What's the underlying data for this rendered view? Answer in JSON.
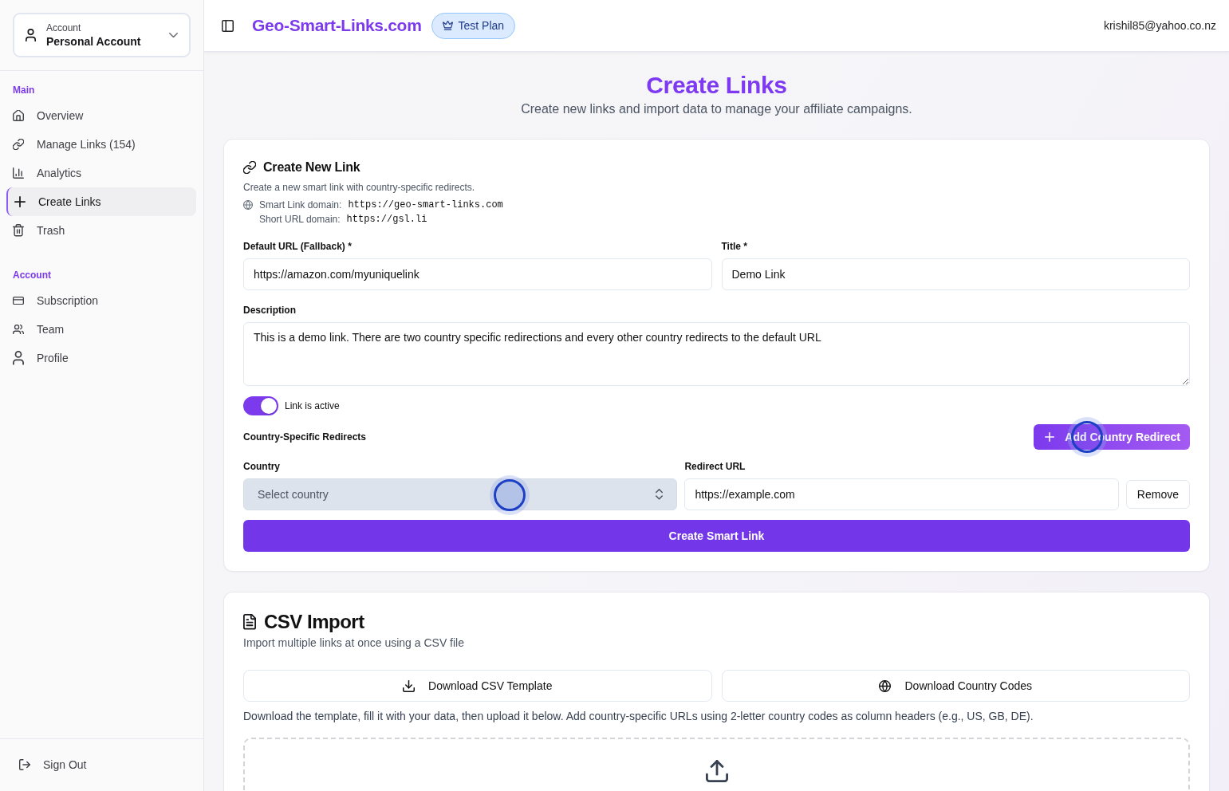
{
  "sidebar": {
    "account_selector": {
      "label": "Account",
      "value": "Personal Account"
    },
    "sections": [
      {
        "heading": "Main",
        "items": [
          {
            "label": "Overview",
            "selected": false
          },
          {
            "label": "Manage Links (154)",
            "selected": false
          },
          {
            "label": "Analytics",
            "selected": false
          },
          {
            "label": "Create Links",
            "selected": true
          },
          {
            "label": "Trash",
            "selected": false
          }
        ]
      },
      {
        "heading": "Account",
        "items": [
          {
            "label": "Subscription",
            "selected": false
          },
          {
            "label": "Team",
            "selected": false
          },
          {
            "label": "Profile",
            "selected": false
          }
        ]
      }
    ],
    "sign_out": "Sign Out"
  },
  "header": {
    "brand": "Geo-Smart-Links.com",
    "plan_badge": "Test Plan",
    "user_email": "krishil85@yahoo.co.nz"
  },
  "page": {
    "title": "Create Links",
    "subtitle": "Create new links and import data to manage your affiliate campaigns."
  },
  "create_link": {
    "title": "Create New Link",
    "description": "Create a new smart link with country-specific redirects.",
    "domains": [
      {
        "label": "Smart Link domain:",
        "value": "https://geo-smart-links.com"
      },
      {
        "label": "Short URL domain:",
        "value": "https://gsl.li"
      }
    ],
    "fields": [
      {
        "label": "Default URL (Fallback) *",
        "value": "https://amazon.com/myuniquelink"
      },
      {
        "label": "Title *",
        "value": "Demo Link"
      }
    ],
    "description_field": {
      "label": "Description",
      "value": "This is a demo link. There are two country specific redirections and every other country redirects to the default URL"
    },
    "active_toggle": {
      "label": "Link is active",
      "on": true
    },
    "redirects": {
      "heading": "Country-Specific Redirects",
      "add_button": {
        "label": "Add Country Redirect",
        "clicked": true
      },
      "country_label": "Country",
      "url_label": "Redirect URL",
      "rows": [
        {
          "country": {
            "placeholder": "Select country",
            "clicked": true
          },
          "url": "https://example.com",
          "remove_button": "Remove"
        }
      ]
    },
    "submit_button": "Create Smart Link"
  },
  "csv_import": {
    "title": "CSV Import",
    "subtitle": "Import multiple links at once using a CSV file",
    "buttons": [
      "Download CSV Template",
      "Download Country Codes"
    ],
    "instructions": "Download the template, fill it with your data, then upload it below. Add country-specific URLs using 2-letter country codes as column headers (e.g., US, GB, DE)."
  }
}
